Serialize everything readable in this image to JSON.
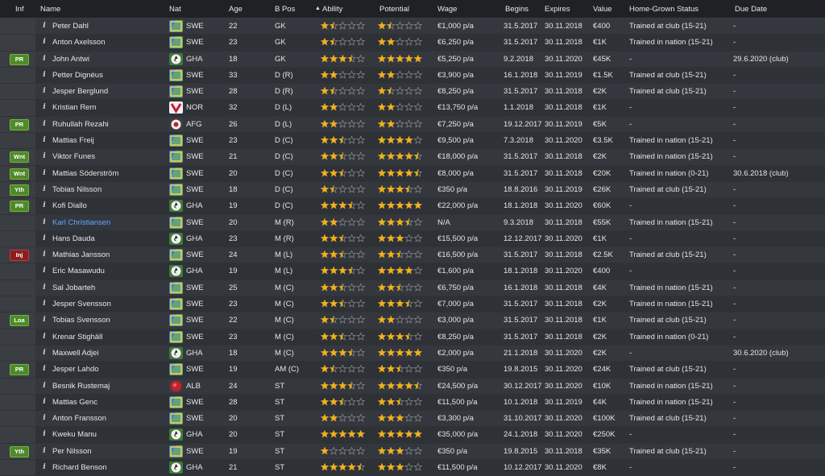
{
  "columns": {
    "inf": "Inf",
    "name": "Name",
    "nat": "Nat",
    "age": "Age",
    "bpos": "B Pos",
    "ability": "Ability",
    "sort_indicator": "▲",
    "potential": "Potential",
    "wage": "Wage",
    "begins": "Begins",
    "expires": "Expires",
    "value": "Value",
    "hg": "Home-Grown Status",
    "due": "Due Date"
  },
  "colors": {
    "star": "#f2b31b",
    "star_empty": "#8a8d92",
    "green_badge": "#4f8a2a",
    "red_badge": "#8a1f1f",
    "link": "#5fa8ff"
  },
  "players": [
    {
      "inf": "",
      "name": "Peter Dahl",
      "flag": "swe",
      "nat": "SWE",
      "age": "22",
      "bpos": "GK",
      "ability": 1.5,
      "potential": 1.5,
      "wage": "€1,000 p/a",
      "begins": "31.5.2017",
      "expires": "30.11.2018",
      "value": "€400",
      "hg": "Trained at club (15-21)",
      "due": "-"
    },
    {
      "inf": "",
      "name": "Anton Axelsson",
      "flag": "swe",
      "nat": "SWE",
      "age": "23",
      "bpos": "GK",
      "ability": 1.5,
      "potential": 2,
      "wage": "€6,250 p/a",
      "begins": "31.5.2017",
      "expires": "30.11.2018",
      "value": "€1K",
      "hg": "Trained in nation (15-21)",
      "due": "-"
    },
    {
      "inf": "PR",
      "name": "John Antwi",
      "flag": "gha",
      "nat": "GHA",
      "age": "18",
      "bpos": "GK",
      "ability": 3.5,
      "potential": 5,
      "wage": "€5,250 p/a",
      "begins": "9.2.2018",
      "expires": "30.11.2020",
      "value": "€45K",
      "hg": "-",
      "due": "29.6.2020 (club)"
    },
    {
      "inf": "",
      "name": "Petter Dignéus",
      "flag": "swe",
      "nat": "SWE",
      "age": "33",
      "bpos": "D (R)",
      "ability": 2,
      "potential": 2,
      "wage": "€3,900 p/a",
      "begins": "16.1.2018",
      "expires": "30.11.2019",
      "value": "€1.5K",
      "hg": "Trained at club (15-21)",
      "due": "-"
    },
    {
      "inf": "",
      "name": "Jesper Berglund",
      "flag": "swe",
      "nat": "SWE",
      "age": "28",
      "bpos": "D (R)",
      "ability": 1.5,
      "potential": 1.5,
      "wage": "€8,250 p/a",
      "begins": "31.5.2017",
      "expires": "30.11.2018",
      "value": "€2K",
      "hg": "Trained at club (15-21)",
      "due": "-"
    },
    {
      "inf": "",
      "name": "Kristian Rem",
      "flag": "nor",
      "nat": "NOR",
      "age": "32",
      "bpos": "D (L)",
      "ability": 2,
      "potential": 2,
      "wage": "€13,750 p/a",
      "begins": "1.1.2018",
      "expires": "30.11.2018",
      "value": "€1K",
      "hg": "-",
      "due": "-"
    },
    {
      "inf": "PR",
      "name": "Ruhullah Rezahi",
      "flag": "afg",
      "nat": "AFG",
      "age": "26",
      "bpos": "D (L)",
      "ability": 2,
      "potential": 2,
      "wage": "€7,250 p/a",
      "begins": "19.12.2017",
      "expires": "30.11.2019",
      "value": "€5K",
      "hg": "-",
      "due": "-"
    },
    {
      "inf": "",
      "name": "Mattias Freij",
      "flag": "swe",
      "nat": "SWE",
      "age": "23",
      "bpos": "D (C)",
      "ability": 2.5,
      "potential": 4,
      "wage": "€9,500 p/a",
      "begins": "7.3.2018",
      "expires": "30.11.2020",
      "value": "€3.5K",
      "hg": "Trained in nation (15-21)",
      "due": "-"
    },
    {
      "inf": "Wnt",
      "name": "Viktor Funes",
      "flag": "swe",
      "nat": "SWE",
      "age": "21",
      "bpos": "D (C)",
      "ability": 2.5,
      "potential": 4.5,
      "wage": "€18,000 p/a",
      "begins": "31.5.2017",
      "expires": "30.11.2018",
      "value": "€2K",
      "hg": "Trained in nation (15-21)",
      "due": "-"
    },
    {
      "inf": "Wnt",
      "name": "Mattias Söderström",
      "flag": "swe",
      "nat": "SWE",
      "age": "20",
      "bpos": "D (C)",
      "ability": 2.5,
      "potential": 4.5,
      "wage": "€8,000 p/a",
      "begins": "31.5.2017",
      "expires": "30.11.2018",
      "value": "€20K",
      "hg": "Trained in nation (0-21)",
      "due": "30.6.2018 (club)"
    },
    {
      "inf": "Yth",
      "name": "Tobias Nilsson",
      "flag": "swe",
      "nat": "SWE",
      "age": "18",
      "bpos": "D (C)",
      "ability": 1.5,
      "potential": 3.5,
      "wage": "€350 p/a",
      "begins": "18.8.2016",
      "expires": "30.11.2019",
      "value": "€26K",
      "hg": "Trained at club (15-21)",
      "due": "-"
    },
    {
      "inf": "PR",
      "name": "Kofi Diallo",
      "flag": "gha",
      "nat": "GHA",
      "age": "19",
      "bpos": "D (C)",
      "ability": 3.5,
      "potential": 5,
      "wage": "€22,000 p/a",
      "begins": "18.1.2018",
      "expires": "30.11.2020",
      "value": "€60K",
      "hg": "-",
      "due": "-"
    },
    {
      "inf": "",
      "name": "Karl Christiansen",
      "flag": "swe",
      "nat": "SWE",
      "age": "20",
      "bpos": "M (R)",
      "ability": 2,
      "potential": 3.5,
      "wage": "N/A",
      "begins": "9.3.2018",
      "expires": "30.11.2018",
      "value": "€55K",
      "hg": "Trained in nation (15-21)",
      "due": "-",
      "link": true
    },
    {
      "inf": "",
      "name": "Hans Dauda",
      "flag": "gha",
      "nat": "GHA",
      "age": "23",
      "bpos": "M (R)",
      "ability": 2.5,
      "potential": 3,
      "wage": "€15,500 p/a",
      "begins": "12.12.2017",
      "expires": "30.11.2020",
      "value": "€1K",
      "hg": "-",
      "due": "-"
    },
    {
      "inf": "Inj",
      "name": "Mathias Jansson",
      "flag": "swe",
      "nat": "SWE",
      "age": "24",
      "bpos": "M (L)",
      "ability": 2.5,
      "potential": 2.5,
      "wage": "€16,500 p/a",
      "begins": "31.5.2017",
      "expires": "30.11.2018",
      "value": "€2.5K",
      "hg": "Trained at club (15-21)",
      "due": "-"
    },
    {
      "inf": "",
      "name": "Eric Masawudu",
      "flag": "gha",
      "nat": "GHA",
      "age": "19",
      "bpos": "M (L)",
      "ability": 3.5,
      "potential": 4,
      "wage": "€1,600 p/a",
      "begins": "18.1.2018",
      "expires": "30.11.2020",
      "value": "€400",
      "hg": "-",
      "due": "-"
    },
    {
      "inf": "",
      "name": "Sal Jobarteh",
      "flag": "swe",
      "nat": "SWE",
      "age": "25",
      "bpos": "M (C)",
      "ability": 2.5,
      "potential": 2.5,
      "wage": "€6,750 p/a",
      "begins": "16.1.2018",
      "expires": "30.11.2018",
      "value": "€4K",
      "hg": "Trained in nation (15-21)",
      "due": "-"
    },
    {
      "inf": "",
      "name": "Jesper Svensson",
      "flag": "swe",
      "nat": "SWE",
      "age": "23",
      "bpos": "M (C)",
      "ability": 2.5,
      "potential": 3.5,
      "wage": "€7,000 p/a",
      "begins": "31.5.2017",
      "expires": "30.11.2018",
      "value": "€2K",
      "hg": "Trained in nation (15-21)",
      "due": "-"
    },
    {
      "inf": "Loa",
      "name": "Tobias Svensson",
      "flag": "swe",
      "nat": "SWE",
      "age": "22",
      "bpos": "M (C)",
      "ability": 1.5,
      "potential": 2,
      "wage": "€3,000 p/a",
      "begins": "31.5.2017",
      "expires": "30.11.2018",
      "value": "€1K",
      "hg": "Trained at club (15-21)",
      "due": "-"
    },
    {
      "inf": "",
      "name": "Krenar Stighäll",
      "flag": "swe",
      "nat": "SWE",
      "age": "23",
      "bpos": "M (C)",
      "ability": 2.5,
      "potential": 3.5,
      "wage": "€8,250 p/a",
      "begins": "31.5.2017",
      "expires": "30.11.2018",
      "value": "€2K",
      "hg": "Trained in nation (0-21)",
      "due": "-"
    },
    {
      "inf": "",
      "name": "Maxwell Adjei",
      "flag": "gha",
      "nat": "GHA",
      "age": "18",
      "bpos": "M (C)",
      "ability": 3.5,
      "potential": 5,
      "wage": "€2,000 p/a",
      "begins": "21.1.2018",
      "expires": "30.11.2020",
      "value": "€2K",
      "hg": "-",
      "due": "30.6.2020 (club)"
    },
    {
      "inf": "PR",
      "name": "Jesper Lahdo",
      "flag": "swe",
      "nat": "SWE",
      "age": "19",
      "bpos": "AM (C)",
      "ability": 1.5,
      "potential": 2.5,
      "wage": "€350 p/a",
      "begins": "19.8.2015",
      "expires": "30.11.2020",
      "value": "€24K",
      "hg": "Trained at club (15-21)",
      "due": "-"
    },
    {
      "inf": "",
      "name": "Besnik Rustemaj",
      "flag": "alb",
      "nat": "ALB",
      "age": "24",
      "bpos": "ST",
      "ability": 3.5,
      "potential": 4.5,
      "wage": "€24,500 p/a",
      "begins": "30.12.2017",
      "expires": "30.11.2020",
      "value": "€10K",
      "hg": "Trained in nation (15-21)",
      "due": "-"
    },
    {
      "inf": "",
      "name": "Mattias Genc",
      "flag": "swe",
      "nat": "SWE",
      "age": "28",
      "bpos": "ST",
      "ability": 2.5,
      "potential": 2.5,
      "wage": "€11,500 p/a",
      "begins": "10.1.2018",
      "expires": "30.11.2019",
      "value": "€4K",
      "hg": "Trained in nation (15-21)",
      "due": "-"
    },
    {
      "inf": "",
      "name": "Anton Fransson",
      "flag": "swe",
      "nat": "SWE",
      "age": "20",
      "bpos": "ST",
      "ability": 2,
      "potential": 3,
      "wage": "€3,300 p/a",
      "begins": "31.10.2017",
      "expires": "30.11.2020",
      "value": "€100K",
      "hg": "Trained at club (15-21)",
      "due": "-"
    },
    {
      "inf": "",
      "name": "Kweku Manu",
      "flag": "gha",
      "nat": "GHA",
      "age": "20",
      "bpos": "ST",
      "ability": 5,
      "potential": 5,
      "wage": "€35,000 p/a",
      "begins": "24.1.2018",
      "expires": "30.11.2020",
      "value": "€250K",
      "hg": "-",
      "due": "-"
    },
    {
      "inf": "Yth",
      "name": "Per Nilsson",
      "flag": "swe",
      "nat": "SWE",
      "age": "19",
      "bpos": "ST",
      "ability": 1,
      "potential": 3,
      "wage": "€350 p/a",
      "begins": "19.8.2015",
      "expires": "30.11.2018",
      "value": "€35K",
      "hg": "Trained at club (15-21)",
      "due": "-"
    },
    {
      "inf": "",
      "name": "Richard Benson",
      "flag": "gha",
      "nat": "GHA",
      "age": "21",
      "bpos": "ST",
      "ability": 4.5,
      "potential": 3,
      "wage": "€11,500 p/a",
      "begins": "10.12.2017",
      "expires": "30.11.2020",
      "value": "€8K",
      "hg": "-",
      "due": "-"
    }
  ]
}
